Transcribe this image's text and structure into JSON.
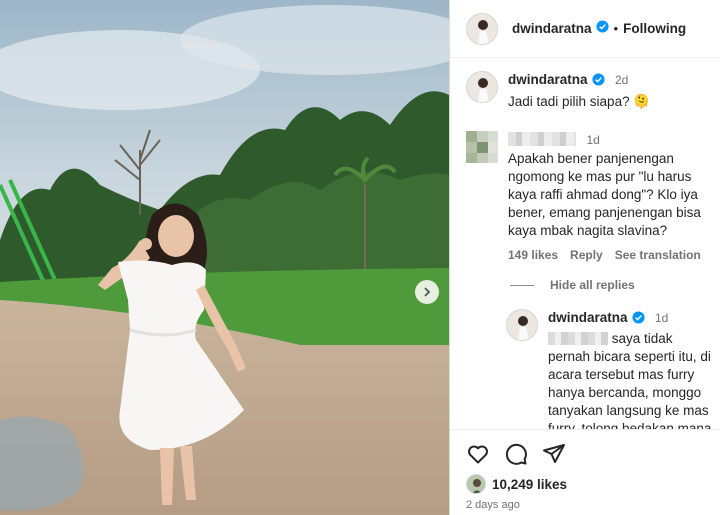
{
  "header": {
    "username": "dwindaratna",
    "separator": "•",
    "follow_label": "Following"
  },
  "caption": {
    "username": "dwindaratna",
    "time": "2d",
    "text": "Jadi tadi pilih siapa? 🫠"
  },
  "comment": {
    "time": "1d",
    "text": "Apakah bener panjenengan ngomong ke mas pur \"lu harus kaya raffi ahmad dong\"? Klo iya bener, emang panjenengan bisa kaya mbak nagita slavina?",
    "likes": "149 likes",
    "reply_label": "Reply",
    "translate_label": "See translation"
  },
  "hide_replies_label": "Hide all replies",
  "reply": {
    "username": "dwindaratna",
    "time": "1d",
    "text": " saya tidak pernah bicara seperti itu, di acara tersebut mas furry hanya bercanda, monggo tanyakan langsung ke mas furry, tolong bedakan mana"
  },
  "post": {
    "likes": "10,249 likes",
    "time": "2 days ago"
  },
  "colors": {
    "verified": "#0095f6",
    "text": "#262626",
    "secondary": "#737373"
  },
  "icons": [
    "heart-icon",
    "comment-icon",
    "share-icon",
    "verified-icon",
    "chevron-right-icon"
  ]
}
